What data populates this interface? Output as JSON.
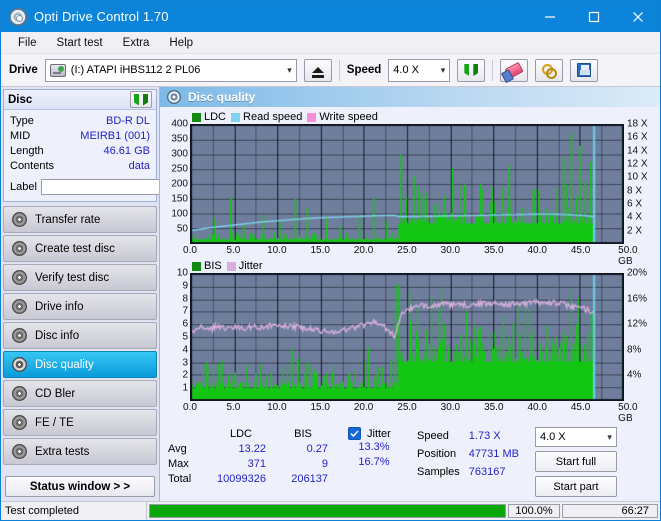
{
  "window": {
    "title": "Opti Drive Control 1.70",
    "icon": "disc-icon",
    "minimize": "−",
    "maximize": "□",
    "close": "✕"
  },
  "menu": {
    "items": [
      "File",
      "Start test",
      "Extra",
      "Help"
    ]
  },
  "toolbar": {
    "drive_label": "Drive",
    "drive_value": "(I:)   ATAPI iHBS112   2 PL06",
    "eject_icon": "eject-icon",
    "speed_label": "Speed",
    "speed_value": "4.0 X",
    "refresh_icon": "refresh-icon",
    "eraser_icon": "eraser-icon",
    "keys_icon": "keys-icon",
    "save_icon": "floppy-save-icon"
  },
  "sidebar": {
    "disc_panel": {
      "title": "Disc",
      "refresh_icon": "refresh-icon",
      "rows": [
        {
          "key": "Type",
          "value": "BD-R DL"
        },
        {
          "key": "MID",
          "value": "MEIRB1 (001)"
        },
        {
          "key": "Length",
          "value": "46.61 GB"
        },
        {
          "key": "Contents",
          "value": "data"
        }
      ],
      "label_key": "Label",
      "label_value": "",
      "label_placeholder": "",
      "disc_button_icon": "cd-disc-icon"
    },
    "nav": [
      {
        "label": "Transfer rate",
        "active": false
      },
      {
        "label": "Create test disc",
        "active": false
      },
      {
        "label": "Verify test disc",
        "active": false
      },
      {
        "label": "Drive info",
        "active": false
      },
      {
        "label": "Disc info",
        "active": false
      },
      {
        "label": "Disc quality",
        "active": true
      },
      {
        "label": "CD Bler",
        "active": false
      },
      {
        "label": "FE / TE",
        "active": false
      },
      {
        "label": "Extra tests",
        "active": false
      }
    ],
    "status_window_button": "Status window > >"
  },
  "main": {
    "header": "Disc quality",
    "header_icon": "disc-quality-icon"
  },
  "chart_data": [
    {
      "type": "line",
      "name": "ldc-chart",
      "title": "",
      "legend": [
        {
          "label": "LDC",
          "color": "#128a12"
        },
        {
          "label": "Read speed",
          "color": "#7fd4f0"
        },
        {
          "label": "Write speed",
          "color": "#f48fd8"
        }
      ],
      "legend_position": "top-left",
      "grid": true,
      "xlabel": "GB",
      "xlim": [
        0,
        50
      ],
      "xticks": [
        "0.0",
        "5.0",
        "10.0",
        "15.0",
        "20.0",
        "25.0",
        "30.0",
        "35.0",
        "40.0",
        "45.0",
        "50.0 GB"
      ],
      "ylabel": "LDC",
      "ylim": [
        0,
        400
      ],
      "yticks": [
        50,
        100,
        150,
        200,
        250,
        300,
        350,
        400
      ],
      "y2label": "Speed",
      "y2lim": [
        0,
        18
      ],
      "y2ticks": [
        "2 X",
        "4 X",
        "6 X",
        "8 X",
        "10 X",
        "12 X",
        "14 X",
        "16 X",
        "18 X"
      ],
      "plot_bg": "#6e7e9c",
      "series": [
        {
          "name": "Read speed",
          "color": "#7fd4f0",
          "x": [
            0,
            2,
            4,
            6,
            8,
            10,
            12,
            14,
            16,
            18,
            20,
            22,
            23.5,
            24,
            26,
            28,
            30,
            32,
            34,
            36,
            38,
            40,
            42,
            44,
            45.5,
            46.6
          ],
          "y": [
            1.9,
            2.3,
            2.6,
            2.9,
            3.2,
            3.4,
            3.6,
            3.8,
            3.9,
            4.0,
            4.1,
            4.2,
            4.25,
            4.0,
            4.05,
            4.1,
            4.15,
            4.2,
            4.25,
            4.3,
            4.35,
            4.4,
            4.4,
            4.3,
            4.2,
            4.0
          ]
        },
        {
          "name": "LDC",
          "color": "#14c614",
          "fill": true,
          "baseline_before_24": 12,
          "baseline_after_24": 70,
          "peaks": [
            {
              "x": 2.6,
              "y": 82
            },
            {
              "x": 4.6,
              "y": 155
            },
            {
              "x": 6.1,
              "y": 60
            },
            {
              "x": 8.3,
              "y": 95
            },
            {
              "x": 10.2,
              "y": 70
            },
            {
              "x": 12.0,
              "y": 150
            },
            {
              "x": 13.4,
              "y": 120
            },
            {
              "x": 15.7,
              "y": 85
            },
            {
              "x": 17.2,
              "y": 60
            },
            {
              "x": 19.4,
              "y": 95
            },
            {
              "x": 21.1,
              "y": 155
            },
            {
              "x": 22.6,
              "y": 75
            },
            {
              "x": 24.2,
              "y": 300
            },
            {
              "x": 24.9,
              "y": 155
            },
            {
              "x": 25.7,
              "y": 225
            },
            {
              "x": 26.6,
              "y": 170
            },
            {
              "x": 28.1,
              "y": 130
            },
            {
              "x": 30.2,
              "y": 255
            },
            {
              "x": 31.6,
              "y": 110
            },
            {
              "x": 33.4,
              "y": 200
            },
            {
              "x": 35.1,
              "y": 140
            },
            {
              "x": 36.8,
              "y": 265
            },
            {
              "x": 38.3,
              "y": 120
            },
            {
              "x": 40.2,
              "y": 180
            },
            {
              "x": 41.6,
              "y": 105
            },
            {
              "x": 43.1,
              "y": 290
            },
            {
              "x": 44.0,
              "y": 370
            },
            {
              "x": 44.9,
              "y": 330
            },
            {
              "x": 45.6,
              "y": 210
            },
            {
              "x": 46.2,
              "y": 275
            }
          ]
        }
      ],
      "end_marker_x": 46.6,
      "end_marker_color": "#6fe0f5"
    },
    {
      "type": "line",
      "name": "bis-chart",
      "title": "",
      "legend": [
        {
          "label": "BIS",
          "color": "#128a12"
        },
        {
          "label": "Jitter",
          "color": "#d9aede"
        }
      ],
      "legend_position": "top-left",
      "grid": true,
      "xlabel": "GB",
      "xlim": [
        0,
        50
      ],
      "xticks": [
        "0.0",
        "5.0",
        "10.0",
        "15.0",
        "20.0",
        "25.0",
        "30.0",
        "35.0",
        "40.0",
        "45.0",
        "50.0 GB"
      ],
      "ylabel": "BIS",
      "ylim": [
        0,
        10
      ],
      "yticks": [
        1,
        2,
        3,
        4,
        5,
        6,
        7,
        8,
        9,
        10
      ],
      "y2label": "Jitter",
      "y2lim": [
        0,
        20
      ],
      "y2ticks": [
        "4%",
        "8%",
        "12%",
        "16%",
        "20%"
      ],
      "plot_bg": "#6e7e9c",
      "series": [
        {
          "name": "Jitter",
          "color": "#d9aede",
          "x": [
            0,
            1,
            2,
            3,
            4,
            5,
            6,
            7,
            8,
            9,
            10,
            11,
            12,
            13,
            14,
            15,
            16,
            17,
            18,
            19,
            20,
            21,
            22,
            23,
            23.6,
            24.2,
            25,
            27,
            29,
            31,
            33,
            35,
            37,
            39,
            41,
            43,
            45,
            46.2
          ],
          "y": [
            5.4,
            5.8,
            5.5,
            5.9,
            5.7,
            5.8,
            5.7,
            5.8,
            5.8,
            5.9,
            5.8,
            5.9,
            5.8,
            5.7,
            5.6,
            5.5,
            5.4,
            5.5,
            5.6,
            5.8,
            6.0,
            6.2,
            6.0,
            5.4,
            5.0,
            6.8,
            7.2,
            7.5,
            7.6,
            7.5,
            7.6,
            7.7,
            7.6,
            7.7,
            7.8,
            7.6,
            7.3,
            7.1
          ]
        },
        {
          "name": "BIS",
          "color": "#14c614",
          "fill": true,
          "baseline_before_24": 1.0,
          "baseline_after_24": 3.2,
          "peaks": [
            {
              "x": 1.8,
              "y": 3.0
            },
            {
              "x": 3.2,
              "y": 2.9
            },
            {
              "x": 5.1,
              "y": 2.2
            },
            {
              "x": 7.4,
              "y": 2.1
            },
            {
              "x": 9.2,
              "y": 2.2
            },
            {
              "x": 11.6,
              "y": 4.1
            },
            {
              "x": 12.4,
              "y": 3.3
            },
            {
              "x": 14.1,
              "y": 2.1
            },
            {
              "x": 16.3,
              "y": 2.2
            },
            {
              "x": 18.2,
              "y": 2.0
            },
            {
              "x": 20.4,
              "y": 4.2
            },
            {
              "x": 21.6,
              "y": 2.6
            },
            {
              "x": 23.1,
              "y": 3.1
            },
            {
              "x": 23.6,
              "y": 9.1
            },
            {
              "x": 24.0,
              "y": 9.2
            },
            {
              "x": 25.4,
              "y": 6.2
            },
            {
              "x": 27.1,
              "y": 5.6
            },
            {
              "x": 29.3,
              "y": 6.0
            },
            {
              "x": 31.2,
              "y": 5.2
            },
            {
              "x": 33.4,
              "y": 5.8
            },
            {
              "x": 35.1,
              "y": 5.4
            },
            {
              "x": 37.2,
              "y": 6.1
            },
            {
              "x": 39.4,
              "y": 5.3
            },
            {
              "x": 41.2,
              "y": 5.9
            },
            {
              "x": 43.1,
              "y": 5.5
            },
            {
              "x": 44.6,
              "y": 6.0
            },
            {
              "x": 45.8,
              "y": 5.2
            }
          ]
        }
      ],
      "end_marker_x": 46.6,
      "end_marker_color": "#6fe0f5"
    }
  ],
  "stats": {
    "col_ldc": "LDC",
    "col_bis": "BIS",
    "rows": [
      {
        "label": "Avg",
        "ldc": "13.22",
        "bis": "0.27"
      },
      {
        "label": "Max",
        "ldc": "371",
        "bis": "9"
      },
      {
        "label": "Total",
        "ldc": "10099326",
        "bis": "206137"
      }
    ],
    "jitter": {
      "checkbox_checked": true,
      "label": "Jitter",
      "avg": "13.3%",
      "max": "16.7%"
    },
    "speed_label": "Speed",
    "speed_value": "1.73 X",
    "position_label": "Position",
    "position_value": "47731 MB",
    "samples_label": "Samples",
    "samples_value": "763167",
    "speed_select": "4.0 X",
    "start_full": "Start full",
    "start_part": "Start part"
  },
  "statusbar": {
    "text": "Test completed",
    "progress_percent": 100,
    "percent_label": "100.0%",
    "time": "66:27"
  }
}
